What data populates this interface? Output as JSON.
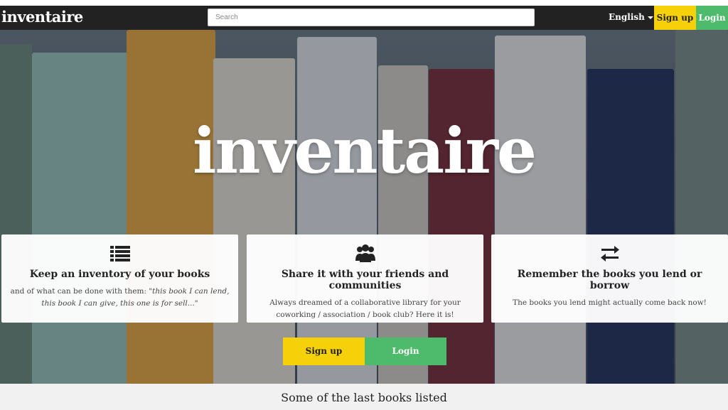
{
  "topbar": {
    "logo": "inventaire",
    "search_placeholder": "Search",
    "language": "English",
    "signup_label": "Sign up",
    "login_label": "Login"
  },
  "hero": {
    "title": "inventaire",
    "cards": [
      {
        "icon": "list-icon",
        "title": "Keep an inventory of your books",
        "text_prefix": "and of what can be done with them: ",
        "text_quote": "\"this book I can lend, this book I can give, this one is for sell...\""
      },
      {
        "icon": "users-icon",
        "title": "Share it with your friends and communities",
        "text": "Always dreamed of a collaborative library for your coworking / association / book club? Here it is!"
      },
      {
        "icon": "exchange-icon",
        "title": "Remember the books you lend or borrow",
        "text": "The books you lend might actually come back now!"
      }
    ],
    "signup_label": "Sign up",
    "login_label": "Login"
  },
  "bottom": {
    "heading": "Some of the last books listed"
  },
  "colors": {
    "topbar_bg": "#222222",
    "signup": "#f6d009",
    "login": "#4ebb6c"
  }
}
